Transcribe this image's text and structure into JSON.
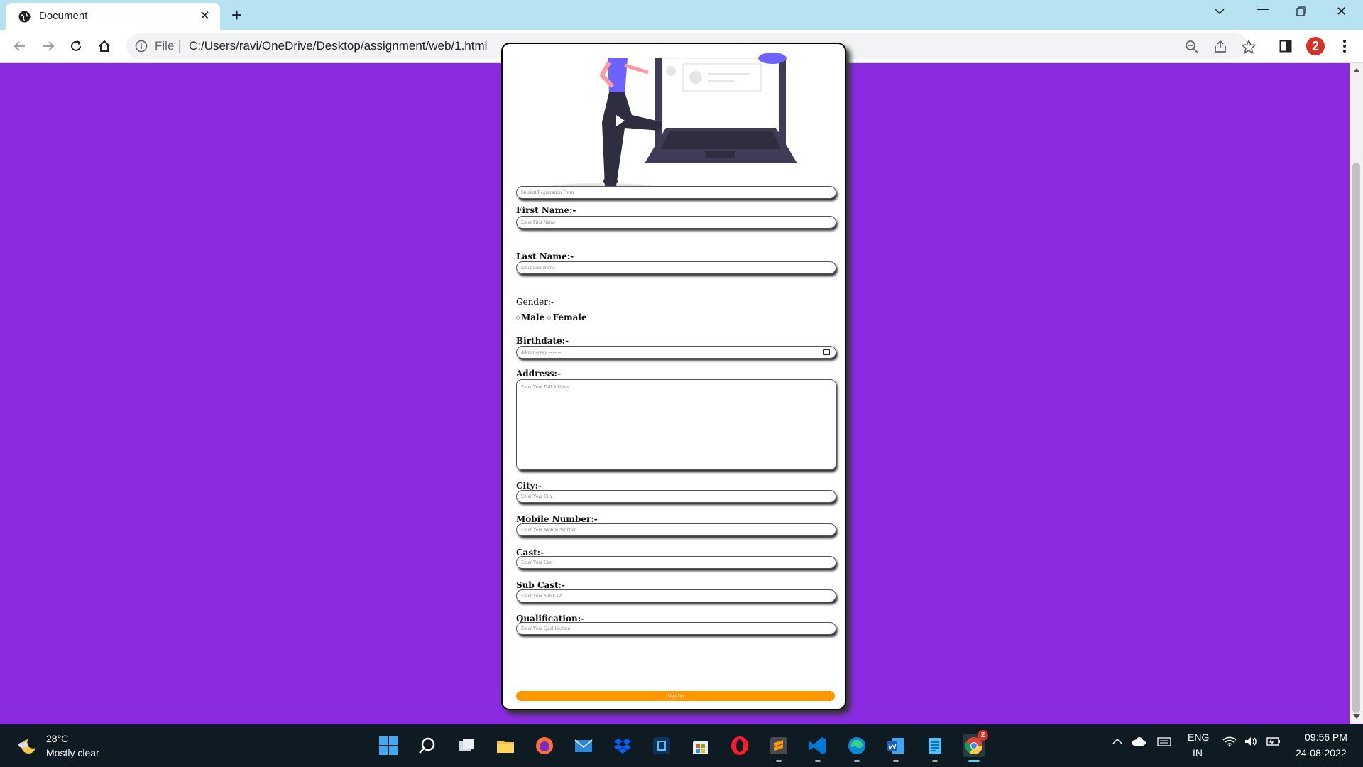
{
  "browser": {
    "tab_title": "Document",
    "address_prefix": "File",
    "url": "C:/Users/ravi/OneDrive/Desktop/assignment/web/1.html",
    "profile_badge": "2"
  },
  "form": {
    "title_placeholder": "Student Registration Form",
    "first_name_label": "First Name:-",
    "first_name_placeholder": "Enter First Name",
    "last_name_label": "Last Name:-",
    "last_name_placeholder": "Enter Last Name",
    "gender_label": "Gender:-",
    "gender_options": [
      "Male",
      "Female"
    ],
    "birthdate_label": "Birthdate:-",
    "birthdate_placeholder": "dd-mm-yyyy --:-- --",
    "address_label": "Address:-",
    "address_placeholder": "Enter Your Full Address",
    "city_label": "City:-",
    "city_placeholder": "Enter Your City",
    "mobile_label": "Mobile Number:-",
    "mobile_placeholder": "Enter Your Mobile Number",
    "cast_label": "Cast:-",
    "cast_placeholder": "Enter Your Cast",
    "subcast_label": "Sub Cast:-",
    "subcast_placeholder": "Enter Your Sub Cast",
    "qualification_label": "Qualification:-",
    "qualification_placeholder": "Enter Your Qualification",
    "signup_label": "Sign Up",
    "signup_color": "#ff9800",
    "page_background": "#8a2be2"
  },
  "taskbar": {
    "weather_temp": "28°C",
    "weather_desc": "Mostly clear",
    "lang_line1": "ENG",
    "lang_line2": "IN",
    "time": "09:56 PM",
    "date": "24-08-2022",
    "chrome_badge": "2",
    "apps": [
      "windows-start-icon",
      "search-icon",
      "task-view-icon",
      "file-explorer-icon",
      "firefox-icon",
      "mail-icon",
      "dropbox-icon",
      "app-icon",
      "store-icon",
      "opera-icon",
      "sublime-text-icon",
      "vscode-icon",
      "edge-icon",
      "word-icon",
      "notepad-icon",
      "chrome-icon"
    ]
  }
}
